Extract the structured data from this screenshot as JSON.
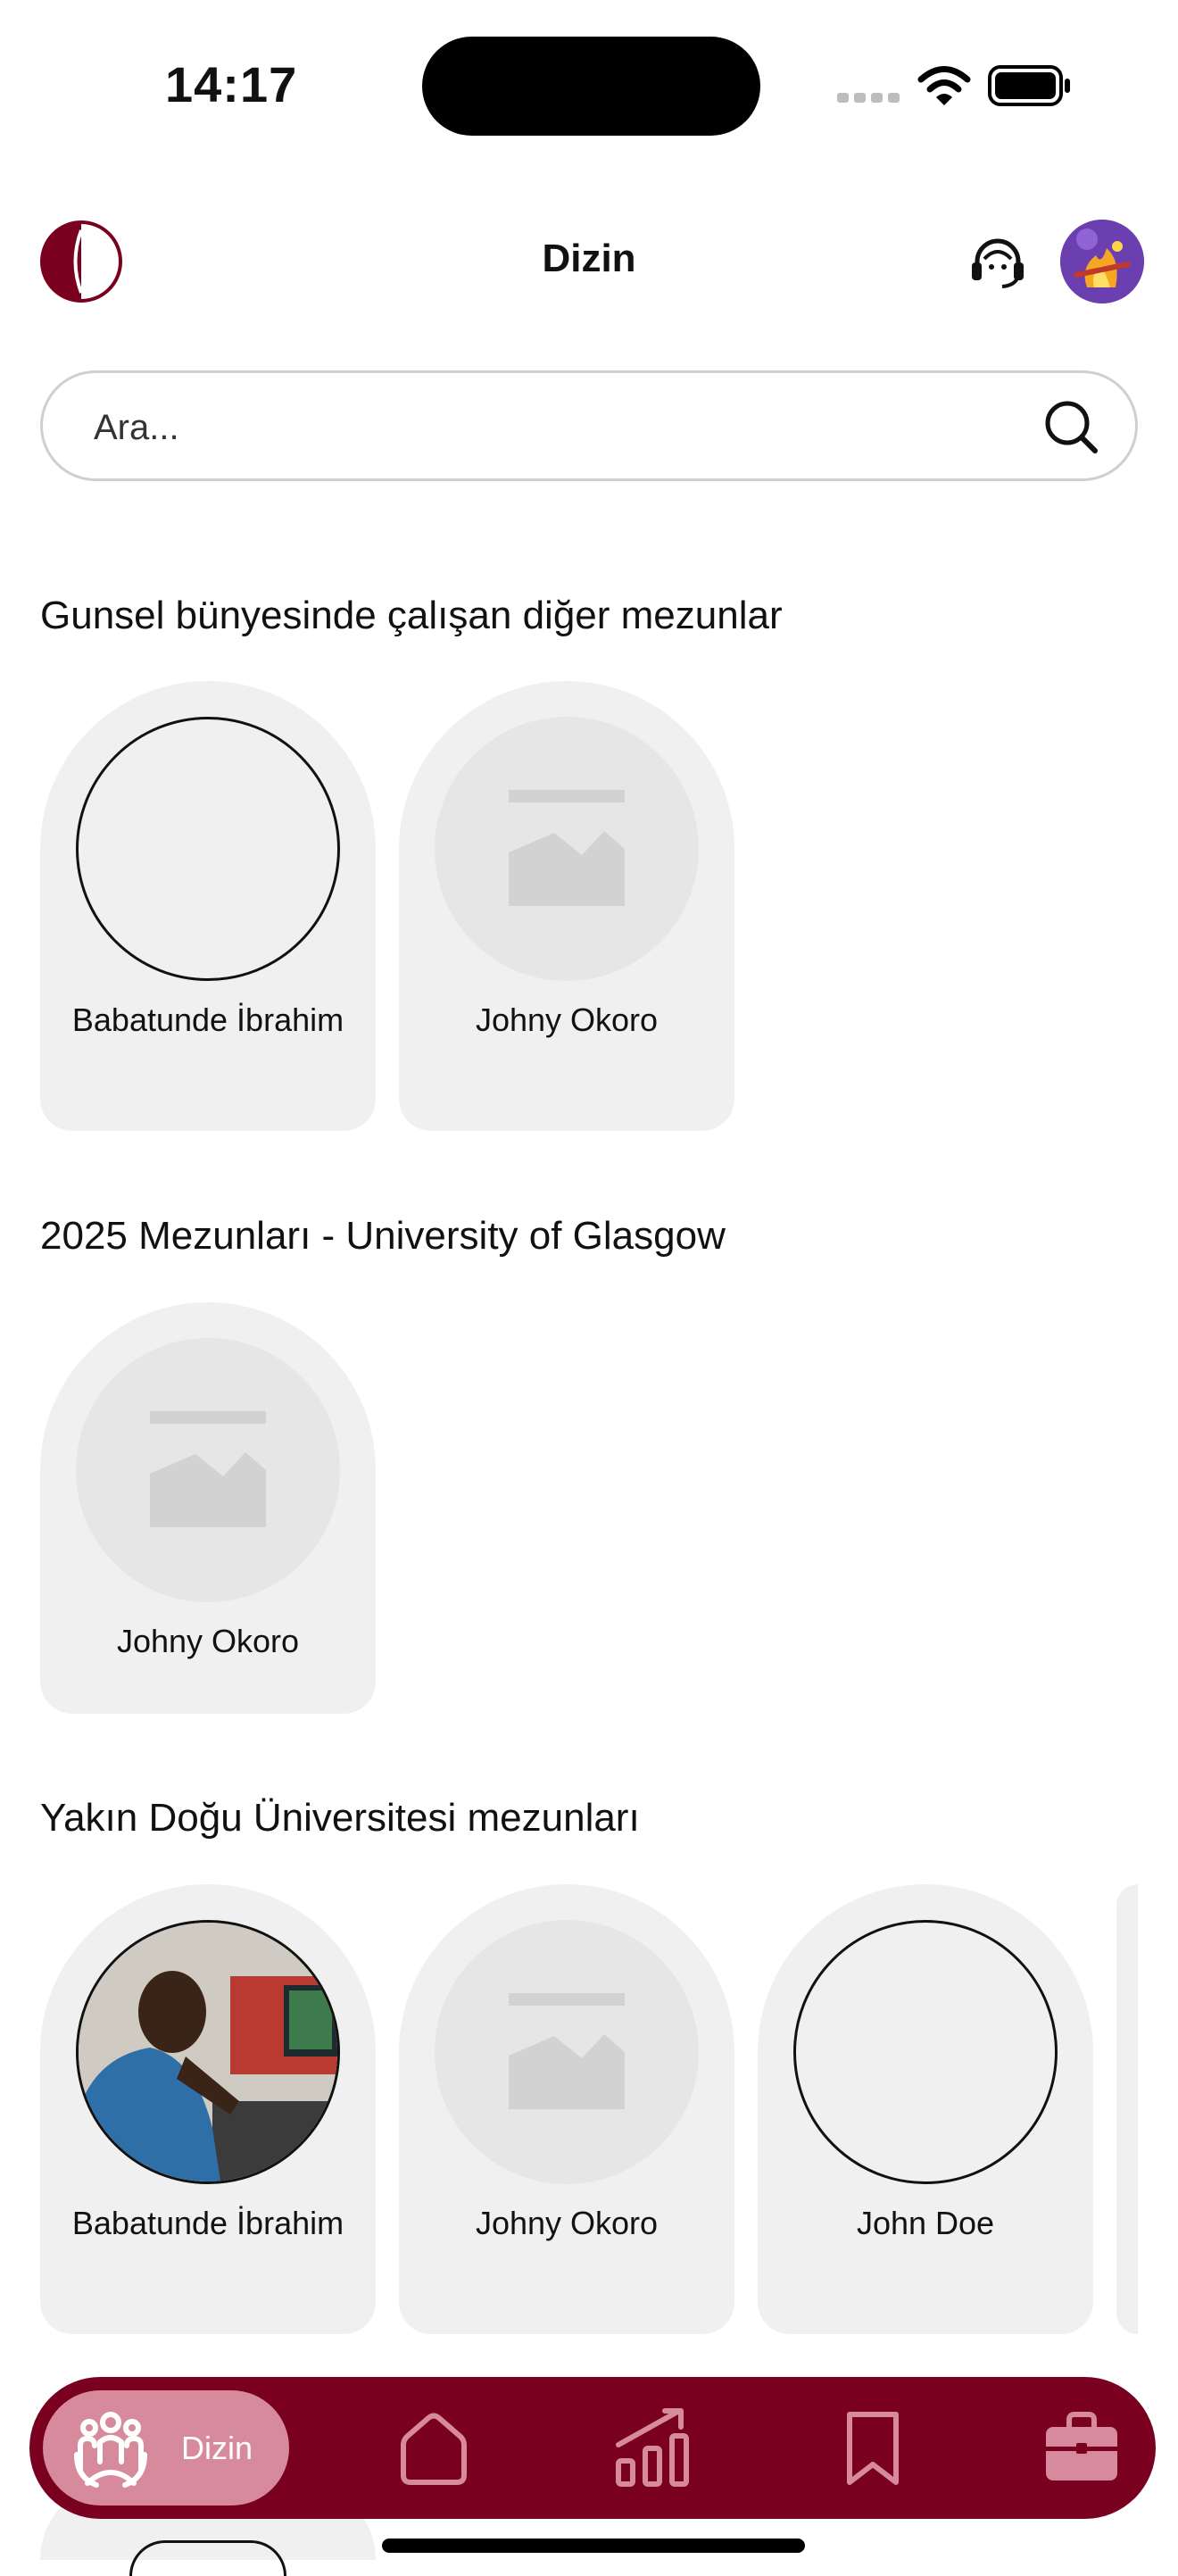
{
  "status_bar": {
    "time": "14:17"
  },
  "header": {
    "title": "Dizin"
  },
  "search": {
    "placeholder": "Ara..."
  },
  "sections": [
    {
      "title": "Gunsel bünyesinde çalışan diğer mezunlar",
      "people": [
        {
          "name": "Babatunde İbrahim",
          "avatar": "empty"
        },
        {
          "name": "Johny Okoro",
          "avatar": "placeholder-image"
        }
      ]
    },
    {
      "title": "2025 Mezunları - University of Glasgow",
      "people": [
        {
          "name": "Johny Okoro",
          "avatar": "placeholder-image"
        }
      ]
    },
    {
      "title": "Yakın Doğu Üniversitesi mezunları",
      "people": [
        {
          "name": "Babatunde İbrahim",
          "avatar": "photo"
        },
        {
          "name": "Johny Okoro",
          "avatar": "placeholder-image"
        },
        {
          "name": "John Doe",
          "avatar": "empty"
        }
      ]
    }
  ],
  "bottom_nav": {
    "items": [
      {
        "label": "Dizin",
        "icon": "people-icon",
        "active": true
      },
      {
        "label": "",
        "icon": "home-icon"
      },
      {
        "label": "",
        "icon": "stats-icon"
      },
      {
        "label": "",
        "icon": "bookmark-icon"
      },
      {
        "label": "",
        "icon": "briefcase-icon"
      }
    ]
  },
  "colors": {
    "brand": "#7a0020",
    "active_pill": "#d68a9b",
    "card_bg": "#f0f0f0"
  }
}
